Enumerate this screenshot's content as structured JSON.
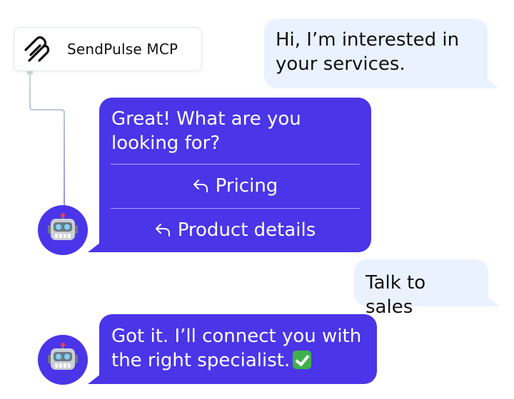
{
  "mcp_card": {
    "title": "SendPulse MCP",
    "logo_icon": "sendpulse-logo-icon"
  },
  "messages": [
    {
      "role": "user",
      "text_lines": [
        "Hi, I’m interested in",
        "your services."
      ]
    },
    {
      "role": "bot",
      "text_lines": [
        "Great! What are you",
        "looking for?"
      ],
      "quick_replies": [
        {
          "label": "Pricing",
          "icon": "reply-arrow-icon"
        },
        {
          "label": "Product details",
          "icon": "reply-arrow-icon"
        }
      ]
    },
    {
      "role": "user",
      "text_lines": [
        "Talk to sales"
      ]
    },
    {
      "role": "bot",
      "text_lines": [
        "Got it. I’ll connect you with",
        "the right specialist."
      ],
      "emoji": "check-mark-emoji"
    }
  ],
  "avatar": {
    "icon": "robot-face-icon"
  },
  "colors": {
    "bot_bubble": "#4b35e8",
    "user_bubble": "#eaf2ff",
    "connector_line": "#9b8fe8",
    "connector_line_start": "#c8dcd3",
    "check": "#3fb14a"
  }
}
